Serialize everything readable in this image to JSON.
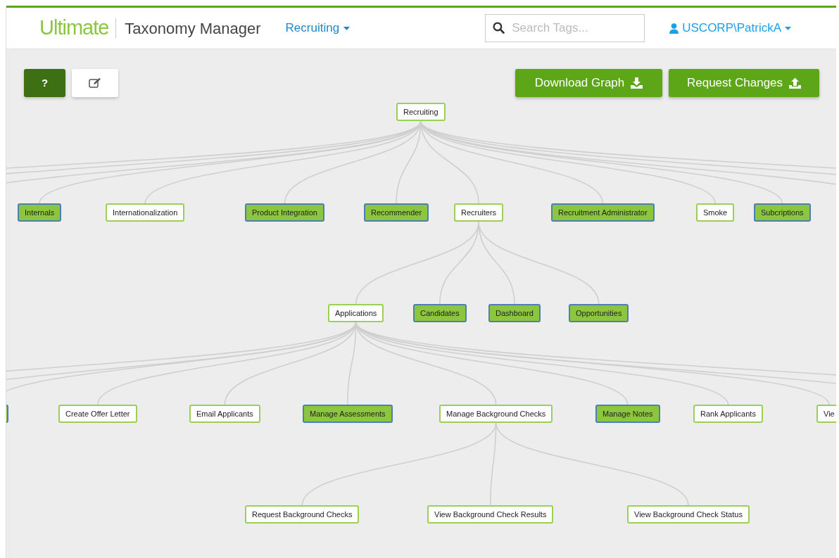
{
  "header": {
    "logo": "Ultimate",
    "title": "Taxonomy Manager",
    "area_menu": "Recruiting",
    "search": {
      "placeholder": "Search Tags..."
    },
    "user": "USCORP\\PatrickA"
  },
  "toolbar": {
    "help_button": {
      "label": "?",
      "active": true
    },
    "edit_button": {
      "active": false
    },
    "actions": [
      {
        "label": "Download Graph",
        "kind": "download"
      },
      {
        "label": "Request Changes",
        "kind": "upload"
      }
    ]
  },
  "graph": {
    "label": "Recruiting",
    "highlighted": false,
    "children": [
      {
        "label": "Internals",
        "highlighted": true
      },
      {
        "label": "Internationalization",
        "highlighted": false
      },
      {
        "label": "Product Integration",
        "highlighted": true
      },
      {
        "label": "Recommender",
        "highlighted": true
      },
      {
        "label": "Recruiters",
        "highlighted": false,
        "children": [
          {
            "label": "Applications",
            "highlighted": false,
            "children": [
              {
                "highlighted": true
              },
              {
                "label": "Create Offer Letter",
                "highlighted": false
              },
              {
                "label": "Email Applicants",
                "highlighted": false
              },
              {
                "label": "Manage Assessments",
                "highlighted": true
              },
              {
                "label": "Manage Background Checks",
                "highlighted": false,
                "children": [
                  {
                    "label": "Request Background Checks",
                    "highlighted": false
                  },
                  {
                    "label": "View Background Check Results",
                    "highlighted": false
                  },
                  {
                    "label": "View Background Check Status",
                    "highlighted": false
                  }
                ]
              },
              {
                "label": "Manage Notes",
                "highlighted": true
              },
              {
                "label": "Rank Applicants",
                "highlighted": false
              },
              {
                "label": "Vie",
                "highlighted": false
              }
            ]
          },
          {
            "label": "Candidates",
            "highlighted": true
          },
          {
            "label": "Dashboard",
            "highlighted": true
          },
          {
            "label": "Opportunities",
            "highlighted": true
          }
        ]
      },
      {
        "label": "Recruitment Administrator",
        "highlighted": true
      },
      {
        "label": "Smoke",
        "highlighted": false
      },
      {
        "label": "Subcriptions",
        "highlighted": true
      }
    ]
  }
}
